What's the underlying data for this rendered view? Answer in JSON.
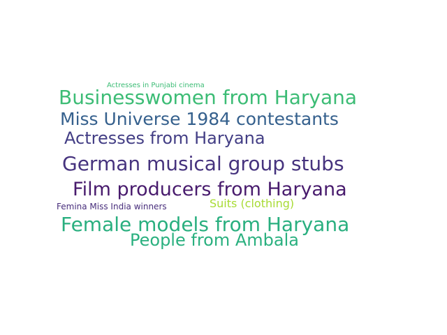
{
  "words": [
    {
      "text": "Actresses in Punjabi cinema",
      "color": "#3cbc75"
    },
    {
      "text": "Businesswomen from Haryana",
      "color": "#3cbc75"
    },
    {
      "text": "Miss Universe 1984 contestants",
      "color": "#35608d"
    },
    {
      "text": "Actresses from Haryana",
      "color": "#433e85"
    },
    {
      "text": "German musical group stubs",
      "color": "#46337e"
    },
    {
      "text": "Film producers from Haryana",
      "color": "#481b6d"
    },
    {
      "text": "Suits (clothing)",
      "color": "#a8db34"
    },
    {
      "text": "Femina Miss India winners",
      "color": "#472d7b"
    },
    {
      "text": "Female models from Haryana",
      "color": "#29af7f"
    },
    {
      "text": "People from Ambala",
      "color": "#2ab07f"
    }
  ]
}
